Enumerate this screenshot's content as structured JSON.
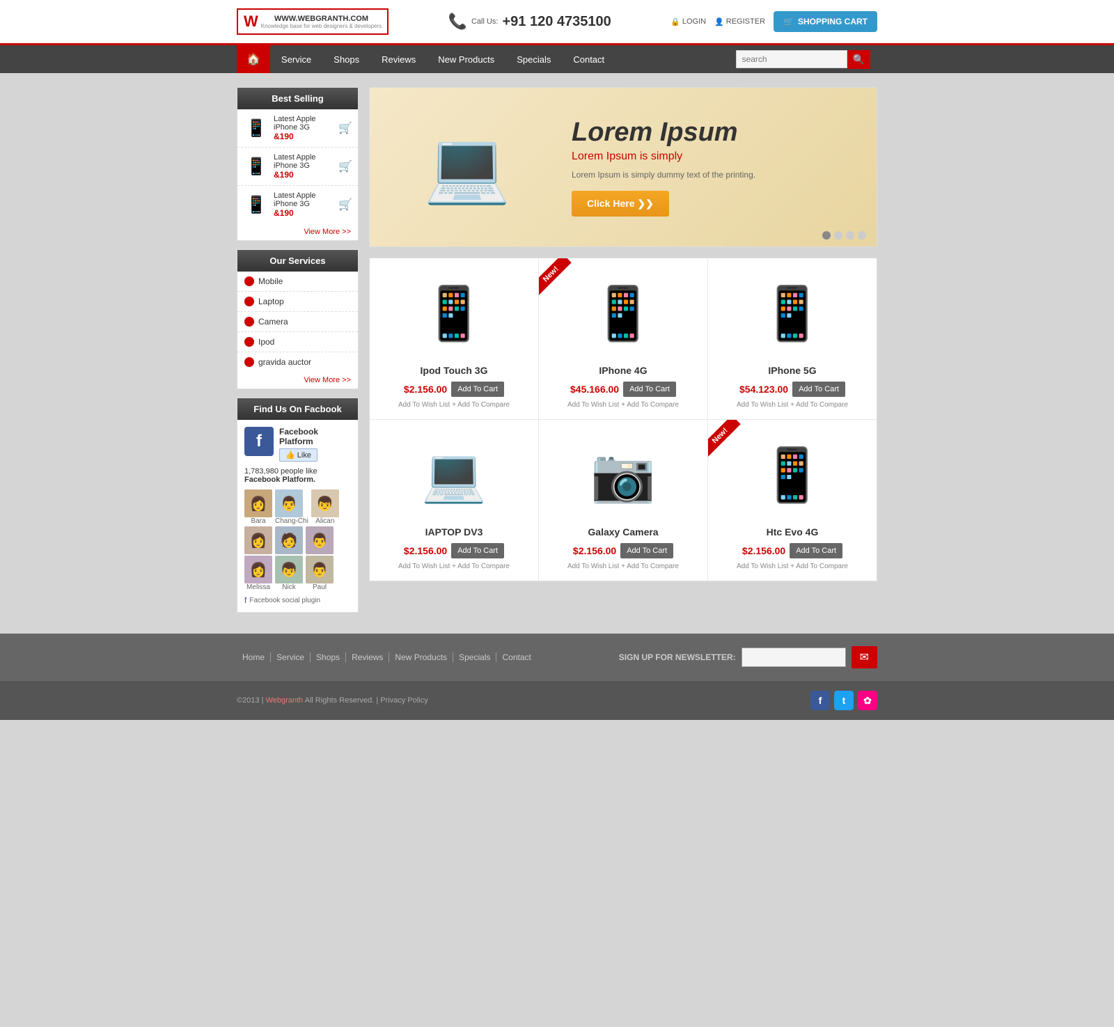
{
  "header": {
    "logo_text": "WWW.WEBGRANTH.COM",
    "logo_tagline": "Knowledge base for web designers & developers",
    "phone_label": "Call Us:",
    "phone_number": "+91 120 4735100",
    "login_label": "LOGIN",
    "register_label": "REGISTER",
    "cart_label": "SHOPPING CART"
  },
  "nav": {
    "home_icon": "🏠",
    "items": [
      {
        "label": "Service",
        "href": "#"
      },
      {
        "label": "Shops",
        "href": "#"
      },
      {
        "label": "Reviews",
        "href": "#"
      },
      {
        "label": "New Products",
        "href": "#"
      },
      {
        "label": "Specials",
        "href": "#"
      },
      {
        "label": "Contact",
        "href": "#"
      }
    ],
    "search_placeholder": "search"
  },
  "sidebar": {
    "best_selling_title": "Best Selling",
    "products": [
      {
        "name": "Latest Apple iPhone 3G",
        "price": "&190",
        "icon": "📱"
      },
      {
        "name": "Latest Apple iPhone 3G",
        "price": "&190",
        "icon": "📱"
      },
      {
        "name": "Latest Apple iPhone 3G",
        "price": "&190",
        "icon": "📱"
      }
    ],
    "view_more": "View More >>",
    "services_title": "Our Services",
    "services": [
      {
        "label": "Mobile"
      },
      {
        "label": "Laptop"
      },
      {
        "label": "Camera"
      },
      {
        "label": "Ipod"
      },
      {
        "label": "gravida auctor"
      }
    ],
    "services_view_more": "View More >>",
    "facebook_title": "Find Us On Facbook",
    "fb_platform": "Facebook Platform",
    "fb_like": "👍 Like",
    "fb_people": "1,783,980 people like ",
    "fb_bold": "Facebook Platform.",
    "fb_avatars_row1": [
      {
        "name": "Bara",
        "icon": "👩"
      },
      {
        "name": "Chang-Chi",
        "icon": "👨"
      },
      {
        "name": "Alican",
        "icon": "👦"
      }
    ],
    "fb_avatars_row2": [
      {
        "icon": "👩"
      },
      {
        "icon": "🧑"
      },
      {
        "icon": "👨"
      }
    ],
    "fb_avatars_row3": [
      {
        "name": "Melissa",
        "icon": "👩"
      },
      {
        "name": "Nick",
        "icon": "👦"
      },
      {
        "name": "Paul",
        "icon": "👨"
      }
    ],
    "fb_plugin": "Facebook social plugin"
  },
  "banner": {
    "title": "Lorem Ipsum",
    "subtitle": "Lorem Ipsum is simply",
    "description": "Lorem Ipsum is simply dummy text of the printing.",
    "button_label": "Click Here  ❯❯",
    "laptop_icon": "💻"
  },
  "products": [
    {
      "name": "Ipod Touch 3G",
      "price": "$2.156.00",
      "add_to_cart": "Add To Cart",
      "wish_list": "Add To Wish List",
      "compare": "+ Add To Compare",
      "icon": "📱",
      "new_badge": false
    },
    {
      "name": "IPhone 4G",
      "price": "$45.166.00",
      "add_to_cart": "Add To Cart",
      "wish_list": "Add To Wish List",
      "compare": "+ Add To Compare",
      "icon": "📱",
      "new_badge": true
    },
    {
      "name": "IPhone 5G",
      "price": "$54.123.00",
      "add_to_cart": "Add To Cart",
      "wish_list": "Add To Wish List",
      "compare": "+ Add To Compare",
      "icon": "📱",
      "new_badge": false
    },
    {
      "name": "IAPTOP DV3",
      "price": "$2.156.00",
      "add_to_cart": "Add To Cart",
      "wish_list": "Add To Wish List",
      "compare": "+ Add To Compare",
      "icon": "💻",
      "new_badge": false
    },
    {
      "name": "Galaxy Camera",
      "price": "$2.156.00",
      "add_to_cart": "Add To Cart",
      "wish_list": "Add To Wish List",
      "compare": "+ Add To Compare",
      "icon": "📷",
      "new_badge": false
    },
    {
      "name": "Htc Evo 4G",
      "price": "$2.156.00",
      "add_to_cart": "Add To Cart",
      "wish_list": "Add To Wish List",
      "compare": "+ Add To Compare",
      "icon": "📱",
      "new_badge": true
    }
  ],
  "footer": {
    "nav_items": [
      {
        "label": "Home"
      },
      {
        "label": "Service"
      },
      {
        "label": "Shops"
      },
      {
        "label": "Reviews"
      },
      {
        "label": "New Products"
      },
      {
        "label": "Specials"
      },
      {
        "label": "Contact"
      }
    ],
    "newsletter_label": "SIGN UP FOR NEWSLETTER:",
    "newsletter_placeholder": "",
    "copyright": "©2013 |",
    "brand": "Webgranth",
    "rights": "All Rights Reserved. | Privacy Policy",
    "social": [
      {
        "icon": "f",
        "class": "fb-social",
        "label": "facebook"
      },
      {
        "icon": "t",
        "class": "tw-social",
        "label": "twitter"
      },
      {
        "icon": "✿",
        "class": "fl-social",
        "label": "flickr"
      }
    ]
  }
}
